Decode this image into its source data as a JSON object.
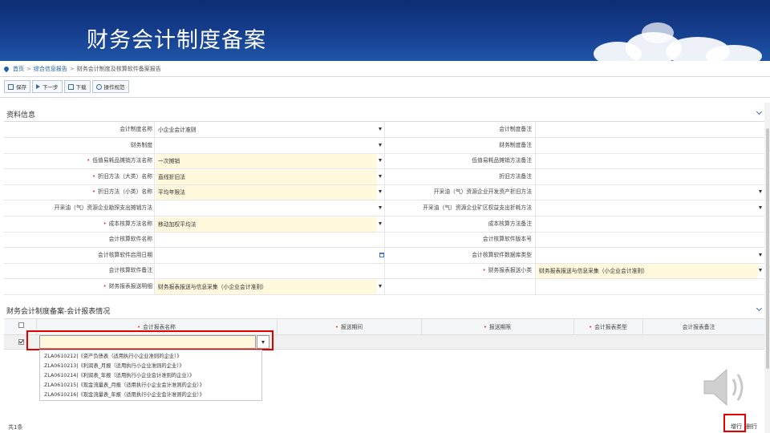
{
  "banner": {
    "title": "财务会计制度备案"
  },
  "breadcrumb": {
    "home": "首页",
    "level1": "综合信息报告",
    "current": "财务会计制度及核算软件备案报告",
    "separator": ">"
  },
  "toolbar": {
    "save": "保存",
    "next": "下一步",
    "download": "下载",
    "guide": "操作规范"
  },
  "section_info": {
    "title": "资料信息"
  },
  "form_rows": [
    {
      "left_label": "会计制度名称",
      "left_required": false,
      "left_value": "小企业会计准则",
      "left_dropdown": true,
      "left_highlight": false,
      "right_label": "会计制度备注",
      "right_required": false,
      "right_value": "",
      "right_dropdown": false,
      "right_highlight": false
    },
    {
      "left_label": "财务制度",
      "left_required": false,
      "left_value": "",
      "left_dropdown": true,
      "left_highlight": false,
      "right_label": "财务制度备注",
      "right_required": false,
      "right_value": "",
      "right_dropdown": false,
      "right_highlight": false
    },
    {
      "left_label": "低值易耗品摊销方法名称",
      "left_required": true,
      "left_value": "一次摊销",
      "left_dropdown": true,
      "left_highlight": true,
      "right_label": "低值易耗品摊销方法备注",
      "right_required": false,
      "right_value": "",
      "right_dropdown": false,
      "right_highlight": false
    },
    {
      "left_label": "折旧方法（大类）名称",
      "left_required": true,
      "left_value": "直线折旧法",
      "left_dropdown": true,
      "left_highlight": true,
      "right_label": "折旧方法备注",
      "right_required": false,
      "right_value": "",
      "right_dropdown": false,
      "right_highlight": false
    },
    {
      "left_label": "折旧方法（小类）名称",
      "left_required": true,
      "left_value": "平均年限法",
      "left_dropdown": true,
      "left_highlight": true,
      "right_label": "开采油（气）资源企业开发资产折旧方法",
      "right_required": false,
      "right_value": "",
      "right_dropdown": true,
      "right_highlight": false
    },
    {
      "left_label": "开采油（气）资源企业勘探支出摊销方法",
      "left_required": false,
      "left_value": "",
      "left_dropdown": true,
      "left_highlight": false,
      "right_label": "开采油（气）资源企业矿区权益支出折耗方法",
      "right_required": false,
      "right_value": "",
      "right_dropdown": true,
      "right_highlight": false
    },
    {
      "left_label": "成本核算方法名称",
      "left_required": true,
      "left_value": "移动加权平均法",
      "left_dropdown": true,
      "left_highlight": true,
      "right_label": "成本核算方法备注",
      "right_required": false,
      "right_value": "",
      "right_dropdown": false,
      "right_highlight": false
    },
    {
      "left_label": "会计核算软件名称",
      "left_required": false,
      "left_value": "",
      "left_dropdown": false,
      "left_highlight": false,
      "right_label": "会计核算软件版本号",
      "right_required": false,
      "right_value": "",
      "right_dropdown": false,
      "right_highlight": false
    },
    {
      "left_label": "会计核算软件启用日期",
      "left_required": false,
      "left_value": "",
      "left_dropdown": false,
      "left_calendar": true,
      "left_highlight": false,
      "right_label": "会计核算软件数据库类型",
      "right_required": false,
      "right_value": "",
      "right_dropdown": true,
      "right_highlight": false
    },
    {
      "left_label": "会计核算软件备注",
      "left_required": false,
      "left_value": "",
      "left_dropdown": false,
      "left_highlight": false,
      "right_label": "财务报表报送小类",
      "right_required": true,
      "right_value": "财务报表报送与信息采集（小企业会计准则）",
      "right_dropdown": true,
      "right_highlight": true
    },
    {
      "left_label": "财务报表报送明细",
      "left_required": true,
      "left_value": "财务报表报送与信息采集（小企业会计准则）",
      "left_dropdown": true,
      "left_highlight": true,
      "right_label": "",
      "right_required": false,
      "right_value": "",
      "right_dropdown": false,
      "right_highlight": false
    }
  ],
  "section_report": {
    "title": "财务会计制度备案-会计报表情况"
  },
  "table": {
    "columns": [
      {
        "label": "会计报表名称",
        "required": true
      },
      {
        "label": "报送期间",
        "required": true
      },
      {
        "label": "报送期限",
        "required": true
      },
      {
        "label": "会计报表类型",
        "required": true
      },
      {
        "label": "会计报表备注",
        "required": false
      }
    ],
    "combo_value": ""
  },
  "dropdown_options": [
    "ZLA0610212|《资产负债表（适用执行小企业准则的企业）》",
    "ZLA0610213|《利润表_月报（适用执行小企业准则的企业）》",
    "ZLA0610214|《利润表_年报（适用执行小企业会计准则的企业）》",
    "ZLA0610215|《现金流量表_月报（适用执行小企业会计准则的企业）》",
    "ZLA0610216|《现金流量表_年报（适用执行小企业会计准则的企业）》"
  ],
  "footer": {
    "total": "共1条",
    "add_row": "增行",
    "delete_row": "删行"
  },
  "colors": {
    "banner": "#163f8f",
    "required_bg": "#fff8dc",
    "link": "#1f5fae",
    "highlight_border": "#e00000"
  }
}
